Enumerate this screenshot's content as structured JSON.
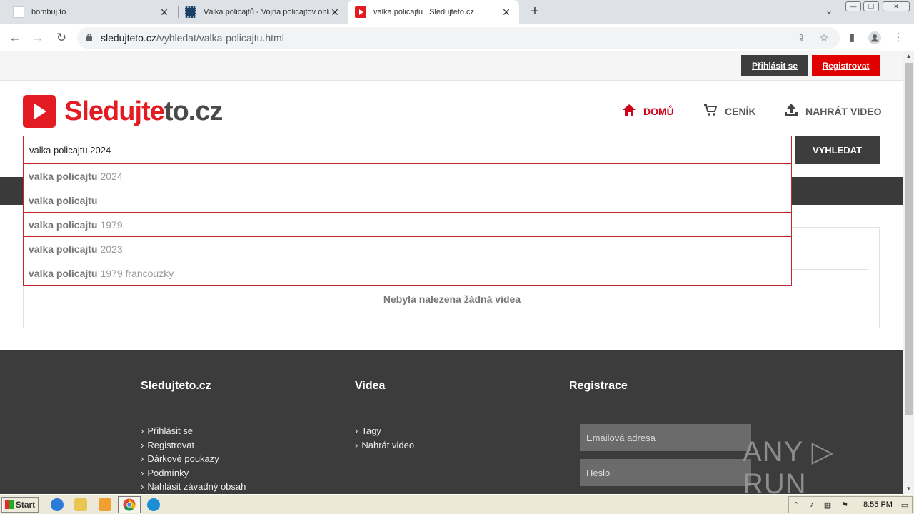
{
  "browser": {
    "tabs": [
      {
        "title": "bombuj.to",
        "favicon_color": "#ffffff"
      },
      {
        "title": "Válka policajtů - Vojna policajtov online",
        "favicon_color": "#1c3f66"
      },
      {
        "title": "valka policajtu | Sledujteto.cz",
        "favicon_color": "#e31b23"
      }
    ],
    "new_tab": "+",
    "url_host": "sledujteto.cz",
    "url_path": "/vyhledat/valka-policajtu.html"
  },
  "site": {
    "login_label": "Přihlásit se",
    "register_label": "Registrovat",
    "logo_red": "Sledujte",
    "logo_grey": "to.cz",
    "nav": {
      "home": "DOMŮ",
      "pricing": "CENÍK",
      "upload": "NAHRÁT VIDEO"
    },
    "search": {
      "value": "valka policajtu 2024",
      "button": "VYHLEDAT"
    },
    "suggestions": [
      {
        "bold": "valka policajtu",
        "rest": "2024"
      },
      {
        "bold": "valka policajtu",
        "rest": ""
      },
      {
        "bold": "valka policajtu",
        "rest": "1979"
      },
      {
        "bold": "valka policajtu",
        "rest": "2023"
      },
      {
        "bold": "valka policajtu",
        "rest": "1979 francouzky"
      }
    ],
    "no_results": "Nebyla nalezena žádná videa",
    "accent_color": "#e31b23"
  },
  "footer": {
    "col1_title": "Sledujteto.cz",
    "col1_links": [
      "Přihlásit se",
      "Registrovat",
      "Dárkové poukazy",
      "Podmínky",
      "Nahlásit závadný obsah"
    ],
    "col2_title": "Videa",
    "col2_links": [
      "Tagy",
      "Nahrát video"
    ],
    "col3_title": "Registrace",
    "email_placeholder": "Emailová adresa",
    "password_placeholder": "Heslo",
    "watermark": "ANY ▷ RUN"
  },
  "taskbar": {
    "start": "Start",
    "clock": "8:55 PM"
  }
}
